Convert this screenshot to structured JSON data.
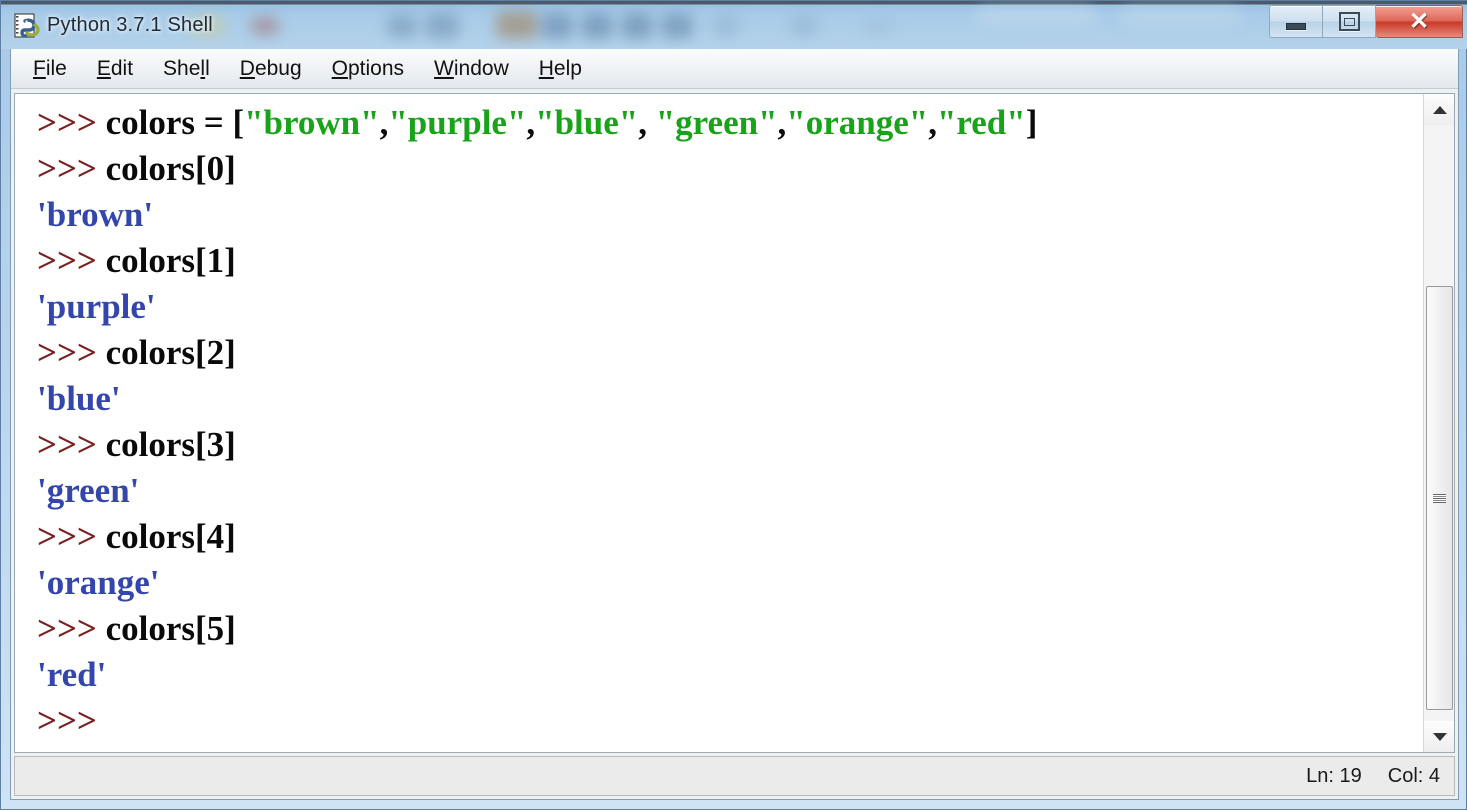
{
  "window": {
    "title": "Python 3.7.1 Shell",
    "icon": "python-idle-icon",
    "controls": {
      "minimize_label": "–",
      "maximize_label": "□",
      "close_label": "✕"
    },
    "accent_colors": {
      "prompt": "#7a2020",
      "code": "#0a0a0a",
      "string": "#19a319",
      "output": "#3446ab",
      "frame": "#b4d2ea",
      "close_button": "#c93a28"
    }
  },
  "menubar": {
    "items": [
      {
        "label": "File",
        "pre": "",
        "mnemonic": "F",
        "post": "ile"
      },
      {
        "label": "Edit",
        "pre": "",
        "mnemonic": "E",
        "post": "dit"
      },
      {
        "label": "Shell",
        "pre": "She",
        "mnemonic": "l",
        "post": "l"
      },
      {
        "label": "Debug",
        "pre": "",
        "mnemonic": "D",
        "post": "ebug"
      },
      {
        "label": "Options",
        "pre": "",
        "mnemonic": "O",
        "post": "ptions"
      },
      {
        "label": "Window",
        "pre": "",
        "mnemonic": "W",
        "post": "indow"
      },
      {
        "label": "Help",
        "pre": "",
        "mnemonic": "H",
        "post": "elp"
      }
    ]
  },
  "shell": {
    "prompt": ">>> ",
    "lines": [
      {
        "type": "input",
        "segments": [
          {
            "kind": "prompt",
            "text": ">>> "
          },
          {
            "kind": "code",
            "text": "colors = ["
          },
          {
            "kind": "string",
            "text": "\"brown\""
          },
          {
            "kind": "code",
            "text": ","
          },
          {
            "kind": "string",
            "text": "\"purple\""
          },
          {
            "kind": "code",
            "text": ","
          },
          {
            "kind": "string",
            "text": "\"blue\""
          },
          {
            "kind": "code",
            "text": ", "
          },
          {
            "kind": "string",
            "text": "\"green\""
          },
          {
            "kind": "code",
            "text": ","
          },
          {
            "kind": "string",
            "text": "\"orange\""
          },
          {
            "kind": "code",
            "text": ","
          },
          {
            "kind": "string",
            "text": "\"red\""
          },
          {
            "kind": "code",
            "text": "]"
          }
        ]
      },
      {
        "type": "input",
        "segments": [
          {
            "kind": "prompt",
            "text": ">>> "
          },
          {
            "kind": "code",
            "text": "colors[0]"
          }
        ]
      },
      {
        "type": "output",
        "segments": [
          {
            "kind": "output",
            "text": "'brown'"
          }
        ]
      },
      {
        "type": "input",
        "segments": [
          {
            "kind": "prompt",
            "text": ">>> "
          },
          {
            "kind": "code",
            "text": "colors[1]"
          }
        ]
      },
      {
        "type": "output",
        "segments": [
          {
            "kind": "output",
            "text": "'purple'"
          }
        ]
      },
      {
        "type": "input",
        "segments": [
          {
            "kind": "prompt",
            "text": ">>> "
          },
          {
            "kind": "code",
            "text": "colors[2]"
          }
        ]
      },
      {
        "type": "output",
        "segments": [
          {
            "kind": "output",
            "text": "'blue'"
          }
        ]
      },
      {
        "type": "input",
        "segments": [
          {
            "kind": "prompt",
            "text": ">>> "
          },
          {
            "kind": "code",
            "text": "colors[3]"
          }
        ]
      },
      {
        "type": "output",
        "segments": [
          {
            "kind": "output",
            "text": "'green'"
          }
        ]
      },
      {
        "type": "input",
        "segments": [
          {
            "kind": "prompt",
            "text": ">>> "
          },
          {
            "kind": "code",
            "text": "colors[4]"
          }
        ]
      },
      {
        "type": "output",
        "segments": [
          {
            "kind": "output",
            "text": "'orange'"
          }
        ]
      },
      {
        "type": "input",
        "segments": [
          {
            "kind": "prompt",
            "text": ">>> "
          },
          {
            "kind": "code",
            "text": "colors[5]"
          }
        ]
      },
      {
        "type": "output",
        "segments": [
          {
            "kind": "output",
            "text": "'red'"
          }
        ]
      },
      {
        "type": "input",
        "segments": [
          {
            "kind": "prompt",
            "text": ">>>"
          }
        ]
      }
    ]
  },
  "scrollbar": {
    "up_arrow": "scroll-up-arrow",
    "down_arrow": "scroll-down-arrow"
  },
  "statusbar": {
    "line_label": "Ln: 19",
    "column_label": "Col: 4"
  }
}
